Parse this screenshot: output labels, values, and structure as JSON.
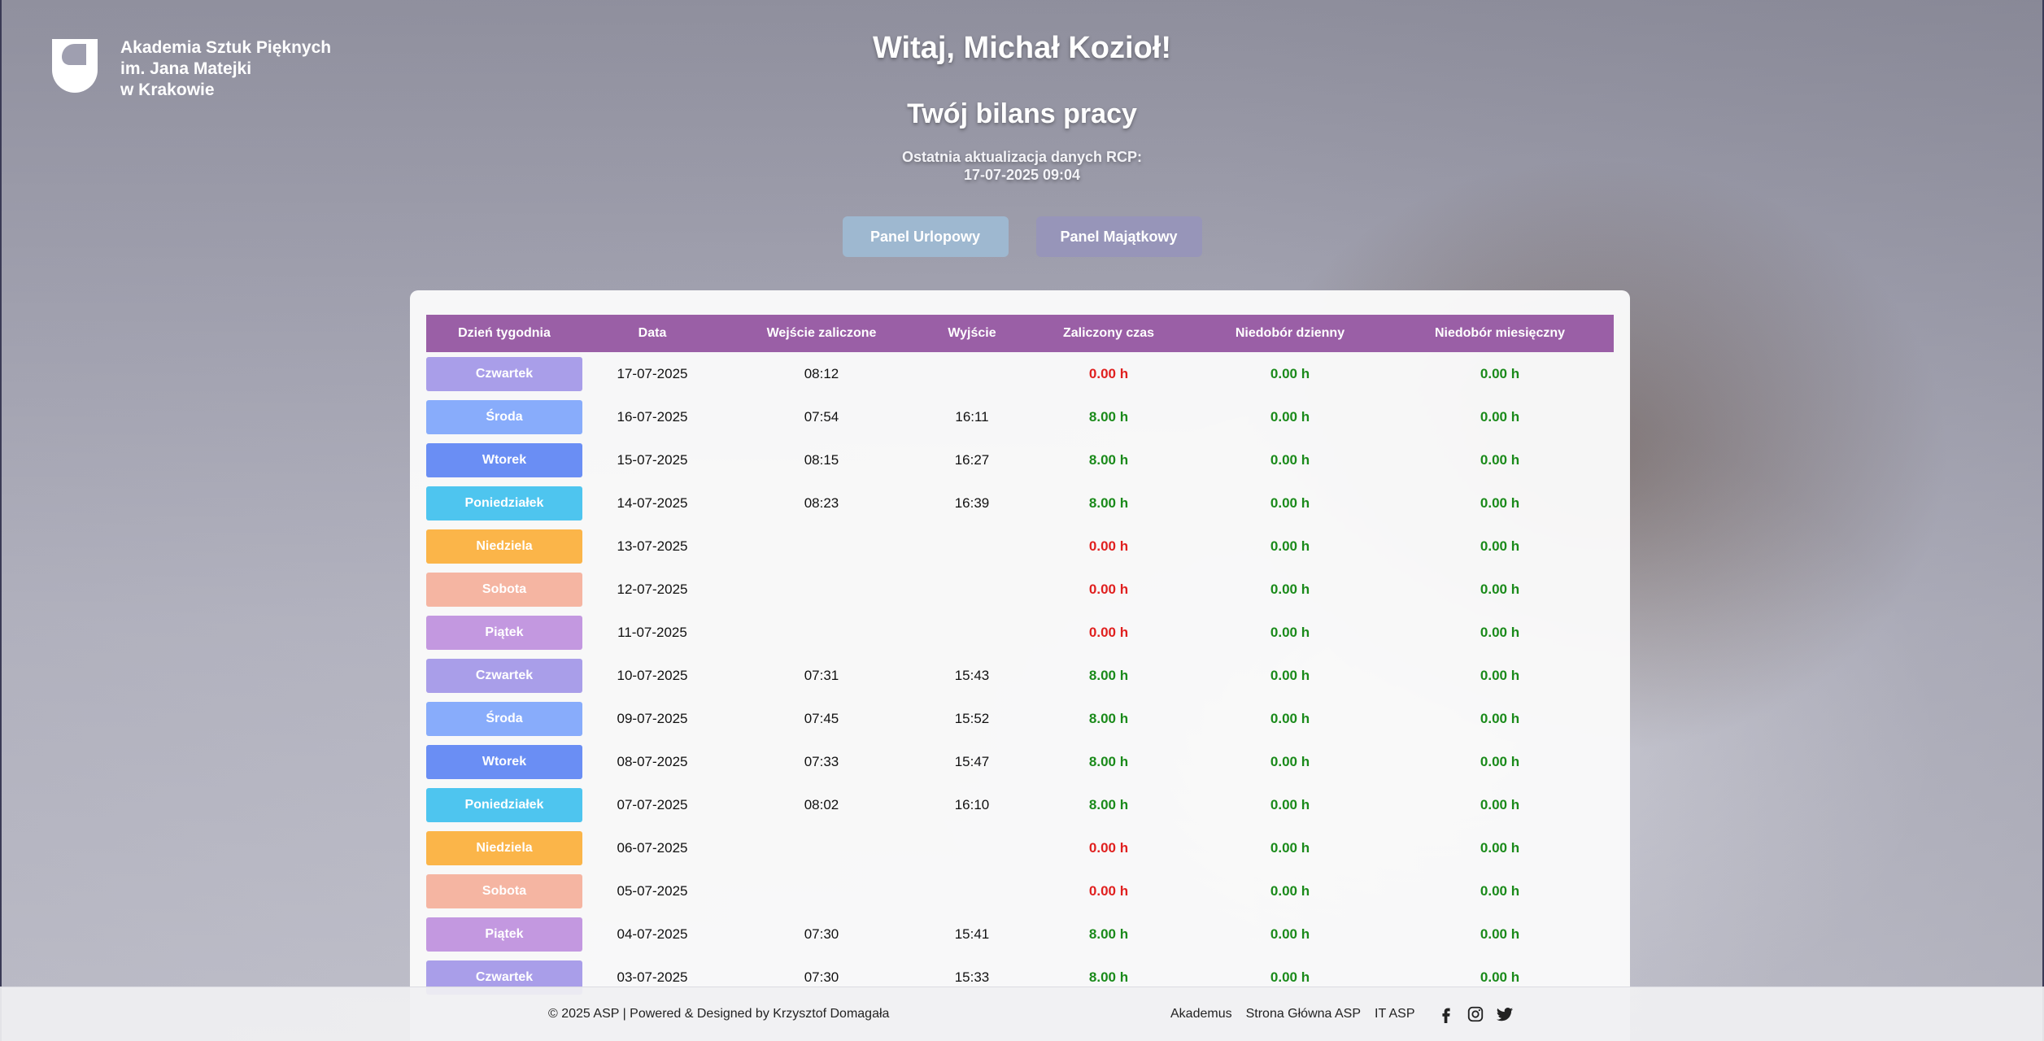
{
  "logo": {
    "line1": "Akademia Sztuk Pięknych",
    "line2": "im. Jana Matejki",
    "line3": "w Krakowie"
  },
  "header": {
    "greeting": "Witaj, Michał Kozioł!",
    "subtitle": "Twój bilans pracy",
    "update_label": "Ostatnia aktualizacja danych RCP:",
    "update_value": "17-07-2025 09:04"
  },
  "buttons": {
    "urlop": "Panel Urlopowy",
    "majatek": "Panel Majątkowy"
  },
  "table": {
    "headers": [
      "Dzień tygodnia",
      "Data",
      "Wejście zaliczone",
      "Wyjście",
      "Zaliczony czas",
      "Niedobór dzienny",
      "Niedobór miesięczny"
    ],
    "rows": [
      {
        "day": "Czwartek",
        "color": "#a99ee9",
        "date": "17-07-2025",
        "in": "08:12",
        "out": "",
        "time": "0.00 h",
        "time_status": "red",
        "daily": "0.00 h",
        "monthly": "0.00 h"
      },
      {
        "day": "Środa",
        "color": "#88acfb",
        "date": "16-07-2025",
        "in": "07:54",
        "out": "16:11",
        "time": "8.00 h",
        "time_status": "green",
        "daily": "0.00 h",
        "monthly": "0.00 h"
      },
      {
        "day": "Wtorek",
        "color": "#6a8ef4",
        "date": "15-07-2025",
        "in": "08:15",
        "out": "16:27",
        "time": "8.00 h",
        "time_status": "green",
        "daily": "0.00 h",
        "monthly": "0.00 h"
      },
      {
        "day": "Poniedziałek",
        "color": "#4ec5ef",
        "date": "14-07-2025",
        "in": "08:23",
        "out": "16:39",
        "time": "8.00 h",
        "time_status": "green",
        "daily": "0.00 h",
        "monthly": "0.00 h"
      },
      {
        "day": "Niedziela",
        "color": "#fbb549",
        "date": "13-07-2025",
        "in": "",
        "out": "",
        "time": "0.00 h",
        "time_status": "red",
        "daily": "0.00 h",
        "monthly": "0.00 h"
      },
      {
        "day": "Sobota",
        "color": "#f5b5a2",
        "date": "12-07-2025",
        "in": "",
        "out": "",
        "time": "0.00 h",
        "time_status": "red",
        "daily": "0.00 h",
        "monthly": "0.00 h"
      },
      {
        "day": "Piątek",
        "color": "#c398e0",
        "date": "11-07-2025",
        "in": "",
        "out": "",
        "time": "0.00 h",
        "time_status": "red",
        "daily": "0.00 h",
        "monthly": "0.00 h"
      },
      {
        "day": "Czwartek",
        "color": "#a99ee9",
        "date": "10-07-2025",
        "in": "07:31",
        "out": "15:43",
        "time": "8.00 h",
        "time_status": "green",
        "daily": "0.00 h",
        "monthly": "0.00 h"
      },
      {
        "day": "Środa",
        "color": "#88acfb",
        "date": "09-07-2025",
        "in": "07:45",
        "out": "15:52",
        "time": "8.00 h",
        "time_status": "green",
        "daily": "0.00 h",
        "monthly": "0.00 h"
      },
      {
        "day": "Wtorek",
        "color": "#6a8ef4",
        "date": "08-07-2025",
        "in": "07:33",
        "out": "15:47",
        "time": "8.00 h",
        "time_status": "green",
        "daily": "0.00 h",
        "monthly": "0.00 h"
      },
      {
        "day": "Poniedziałek",
        "color": "#4ec5ef",
        "date": "07-07-2025",
        "in": "08:02",
        "out": "16:10",
        "time": "8.00 h",
        "time_status": "green",
        "daily": "0.00 h",
        "monthly": "0.00 h"
      },
      {
        "day": "Niedziela",
        "color": "#fbb549",
        "date": "06-07-2025",
        "in": "",
        "out": "",
        "time": "0.00 h",
        "time_status": "red",
        "daily": "0.00 h",
        "monthly": "0.00 h"
      },
      {
        "day": "Sobota",
        "color": "#f5b5a2",
        "date": "05-07-2025",
        "in": "",
        "out": "",
        "time": "0.00 h",
        "time_status": "red",
        "daily": "0.00 h",
        "monthly": "0.00 h"
      },
      {
        "day": "Piątek",
        "color": "#c398e0",
        "date": "04-07-2025",
        "in": "07:30",
        "out": "15:41",
        "time": "8.00 h",
        "time_status": "green",
        "daily": "0.00 h",
        "monthly": "0.00 h"
      },
      {
        "day": "Czwartek",
        "color": "#a99ee9",
        "date": "03-07-2025",
        "in": "07:30",
        "out": "15:33",
        "time": "8.00 h",
        "time_status": "green",
        "daily": "0.00 h",
        "monthly": "0.00 h"
      }
    ]
  },
  "footer": {
    "copyright": "© 2025 ASP | Powered & Designed by Krzysztof Domagała",
    "links": [
      "Akademus",
      "Strona Główna ASP",
      "IT ASP"
    ],
    "social_icons": [
      "facebook-icon",
      "instagram-icon",
      "twitter-icon"
    ]
  },
  "colors": {
    "header_purple": "#9a5fa6",
    "status_red": "#e0201f",
    "status_green": "#1a8a1a"
  }
}
